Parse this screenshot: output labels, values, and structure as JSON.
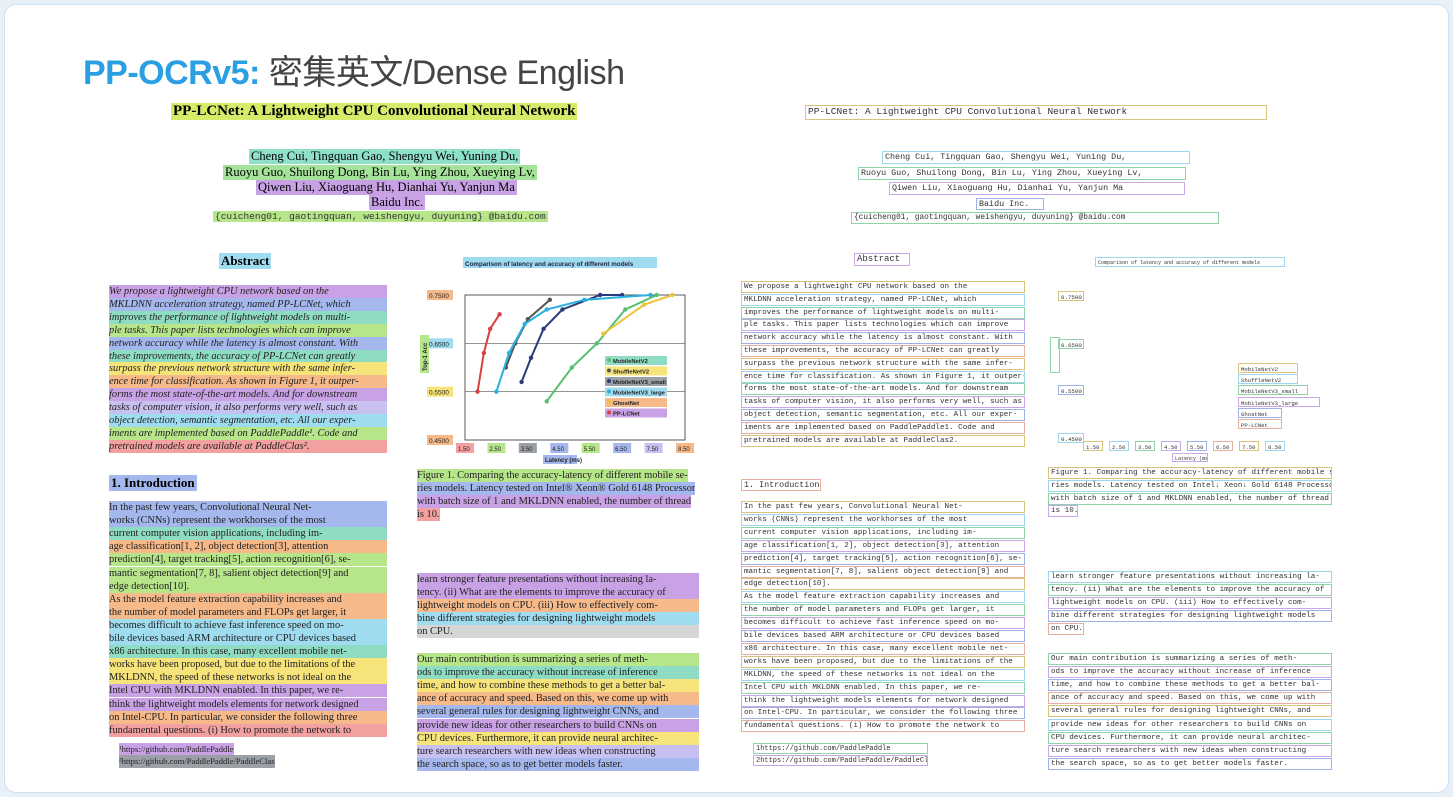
{
  "header": {
    "brand": "PP-OCRv5:",
    "subtitle": "密集英文/Dense English"
  },
  "paper": {
    "title": "PP-LCNet: A Lightweight CPU Convolutional Neural Network",
    "authors": [
      "Cheng Cui, Tingquan Gao, Shengyu Wei, Yuning Du,",
      "Ruoyu Guo, Shuilong Dong, Bin Lu, Ying Zhou, Xueying Lv,",
      "Qiwen Liu, Xiaoguang Hu, Dianhai Yu, Yanjun Ma"
    ],
    "affiliation": "Baidu Inc.",
    "email": "{cuicheng01, gaotingquan, weishengyu, duyuning} @baidu.com",
    "abstract_heading": "Abstract",
    "abstract_lines": [
      "We propose a lightweight CPU network based on the",
      "MKLDNN acceleration strategy, named PP-LCNet, which",
      "improves the performance of lightweight models on multi-",
      "ple tasks. This paper lists technologies which can improve",
      "network accuracy while the latency is almost constant. With",
      "these improvements, the accuracy of PP-LCNet can greatly",
      "surpass the previous network structure with the same infer-",
      "ence time for classification. As shown in Figure 1, it outper-",
      "forms the most state-of-the-art models. And for downstream",
      "tasks of computer vision, it also performs very well, such as",
      "object detection, semantic segmentation, etc. All our exper-",
      "iments are implemented based on PaddlePaddle¹. Code and",
      "pretrained models are available at PaddleClas²."
    ],
    "intro_heading": "1. Introduction",
    "intro_lines": [
      "In the past few years, Convolutional Neural Net-",
      "works (CNNs) represent the workhorses of the most",
      "current computer vision applications, including im-",
      "age classification[1, 2], object detection[3], attention",
      "prediction[4], target tracking[5], action recognition[6], se-",
      "mantic segmentation[7, 8], salient object detection[9] and",
      "edge detection[10].",
      "As the model feature extraction capability increases and",
      "the number of model parameters and FLOPs get larger, it",
      "becomes difficult to achieve fast inference speed on mo-",
      "bile devices based ARM architecture or CPU devices based",
      "x86 architecture. In this case, many excellent mobile net-",
      "works have been proposed, but due to the limitations of the",
      "MKLDNN, the speed of these networks is not ideal on the",
      "Intel CPU with MKLDNN enabled. In this paper, we re-",
      "think the lightweight models elements for network designed",
      "on Intel-CPU. In particular, we consider the following three",
      "fundamental questions. (i) How to promote the network to"
    ],
    "footnotes": [
      "¹https://github.com/PaddlePaddle",
      "²https://github.com/PaddlePaddle/PaddleClas"
    ],
    "figure_caption": [
      "Figure 1. Comparing the accuracy-latency of different mobile se-",
      "ries models. Latency tested on Intel® Xeon® Gold 6148 Processor",
      "with batch size of 1 and MKLDNN enabled, the number of thread",
      "is 10."
    ],
    "right_para1": [
      "learn stronger feature presentations without increasing la-",
      "tency. (ii) What are the elements to improve the accuracy of",
      "lightweight models on CPU. (iii) How to effectively com-",
      "bine different strategies for designing lightweight models",
      "on CPU."
    ],
    "right_para2": [
      "Our main contribution is summarizing a series of meth-",
      "ods to improve the accuracy without increase of inference",
      "time, and how to combine these methods to get a better bal-",
      "ance of accuracy and speed. Based on this, we come up with",
      "several general rules for designing lightweight CNNs, and",
      "provide new ideas for other researchers to build CNNs on",
      "CPU devices. Furthermore, it can provide neural architec-",
      "ture search researchers with new ideas when constructing",
      "the search space, so as to get better models faster."
    ]
  },
  "ocr": {
    "abstract_heading": "Abstract",
    "abstract_lines": [
      "We propose a lightweight CPU network based on the",
      "MKLDNN acceleration strategy, named PP-LCNet, which",
      "improves the performance of lightweight models on multi-",
      "ple tasks. This paper lists technologies which can improve",
      "network accuracy while the latency is almost constant. With",
      "these improvements, the accuracy of PP-LCNet can greatly",
      "surpass the previous network structure with the same infer-",
      "ence time for classification. As shown in Figure 1, it outper-",
      "forms the most state-of-the-art models. And for downstream",
      "tasks of computer vision, it also performs very well, such as",
      "object detection, semantic segmentation, etc. All our exper-",
      "iments are implemented based on PaddlePaddle1. Code and",
      "pretrained models are available at PaddleClas2."
    ],
    "footnotes": [
      "1https://github.com/PaddlePaddle",
      "2https://github.com/PaddlePaddle/PaddleClas"
    ],
    "figure_caption": [
      "Figure 1. Comparing the accuracy-latency of different mobile se-",
      "ries models. Latency tested on Intel↓ Xeon↓ Gold 6148 Processor",
      "with batch size of 1 and MKLDNN enabled, the number of thread",
      "is 10."
    ],
    "legend": [
      "MobileNetV2",
      "ShuffleNetV2",
      "MobileNetV3_small",
      "MobileNetV3_large",
      "GhostNet",
      "PP-LCNet"
    ],
    "latency_label": "Latency (ms)"
  },
  "chart_data": {
    "type": "line",
    "title": "Comparison of latency and accuracy of different models",
    "xlabel": "Latency (ms)",
    "ylabel": "Top-1 Acc",
    "x_ticks": [
      "1.50",
      "2.50",
      "3.50",
      "4.50",
      "5.50",
      "6.50",
      "7.50",
      "8.50"
    ],
    "y_ticks": [
      "0.4500",
      "0.5500",
      "0.6500",
      "0.7500"
    ],
    "xlim": [
      1.5,
      8.5
    ],
    "ylim": [
      0.45,
      0.75
    ],
    "series": [
      {
        "name": "MobileNetV2",
        "color": "#57c06e",
        "x": [
          4.1,
          4.9,
          5.7,
          6.6,
          7.6
        ],
        "y": [
          0.53,
          0.6,
          0.65,
          0.72,
          0.75
        ]
      },
      {
        "name": "ShuffleNetV2",
        "color": "#555555",
        "x": [
          2.8,
          3.1,
          3.5,
          4.2
        ],
        "y": [
          0.6,
          0.65,
          0.7,
          0.74
        ]
      },
      {
        "name": "MobileNetV3_small",
        "color": "#2a3a7a",
        "x": [
          3.3,
          3.6,
          4.0,
          4.6,
          5.8,
          6.5
        ],
        "y": [
          0.57,
          0.62,
          0.68,
          0.72,
          0.76,
          0.77
        ]
      },
      {
        "name": "MobileNetV3_large",
        "color": "#2ab0e0",
        "x": [
          2.5,
          2.9,
          3.4,
          4.1,
          5.3,
          7.4
        ],
        "y": [
          0.55,
          0.63,
          0.69,
          0.72,
          0.74,
          0.75
        ]
      },
      {
        "name": "GhostNet",
        "color": "#f0c040",
        "x": [
          5.9,
          7.2,
          8.1
        ],
        "y": [
          0.67,
          0.73,
          0.76
        ]
      },
      {
        "name": "PP-LCNet",
        "color": "#d94040",
        "x": [
          1.9,
          2.1,
          2.3,
          2.6
        ],
        "y": [
          0.55,
          0.63,
          0.68,
          0.71
        ]
      }
    ],
    "legend_position": "right",
    "grid": true
  }
}
